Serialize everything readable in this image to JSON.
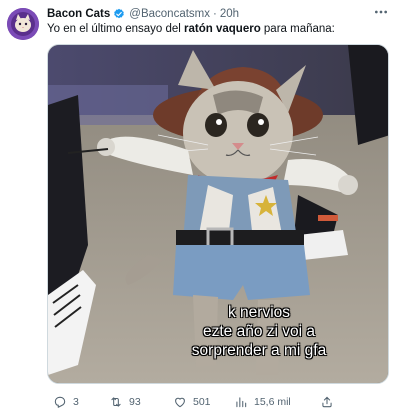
{
  "author": {
    "name": "Bacon Cats",
    "handle": "@Baconcatsmx",
    "separator": "·",
    "time": "20h",
    "verified": true
  },
  "tweet": {
    "text_before": "Yo en el último ensayo del ",
    "text_bold": "ratón vaquero",
    "text_after": " para mañana:"
  },
  "media": {
    "caption_line1": "k nervios",
    "caption_line2": "ezte año zi voi a",
    "caption_line3": "sorprender a mi gfa"
  },
  "actions": {
    "replies": "3",
    "retweets": "93",
    "likes": "501",
    "views": "15,6 mil"
  },
  "icons": {
    "more": "more-horizontal-icon",
    "verified": "verified-badge-icon",
    "reply": "reply-icon",
    "retweet": "retweet-icon",
    "like": "heart-icon",
    "views": "views-icon",
    "share": "share-icon"
  },
  "colors": {
    "text": "#0f1419",
    "secondary": "#536471",
    "verified": "#1d9bf0",
    "avatar": "#6b3fa0"
  }
}
